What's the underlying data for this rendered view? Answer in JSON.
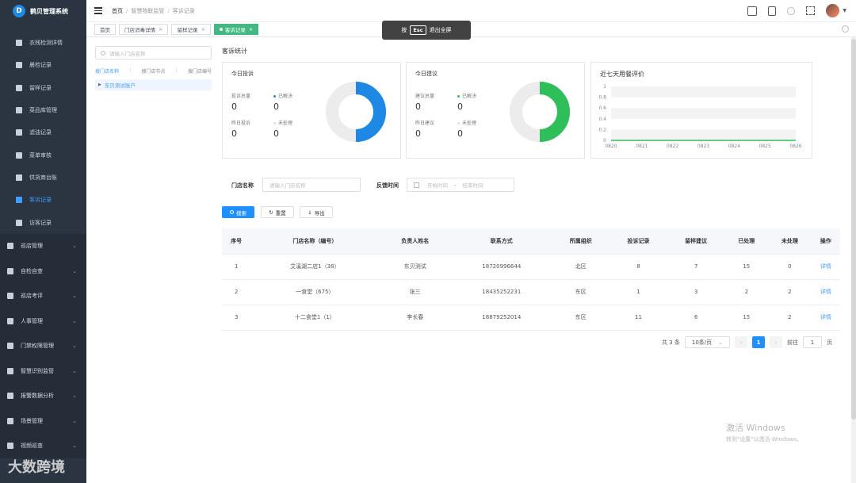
{
  "app": {
    "title": "鹤贝管理系统",
    "logo_letter": "D"
  },
  "sidebar": {
    "sub_items": [
      {
        "label": "衣残检测详情",
        "active": false
      },
      {
        "label": "晨检记录",
        "active": false
      },
      {
        "label": "留样记录",
        "active": false
      },
      {
        "label": "菜品库管理",
        "active": false
      },
      {
        "label": "滤油记录",
        "active": false
      },
      {
        "label": "菜单审核",
        "active": false
      },
      {
        "label": "供货商台账",
        "active": false
      },
      {
        "label": "客诉记录",
        "active": true
      },
      {
        "label": "访客记录",
        "active": false
      }
    ],
    "groups": [
      {
        "label": "巡店管理"
      },
      {
        "label": "自检自查"
      },
      {
        "label": "巡店考评"
      },
      {
        "label": "人事管理"
      },
      {
        "label": "门禁权限管理"
      },
      {
        "label": "智慧识别监管"
      },
      {
        "label": "报警数据分析"
      },
      {
        "label": "场景管理"
      },
      {
        "label": "视频巡查"
      }
    ],
    "watermark": "大数跨境"
  },
  "header": {
    "breadcrumb": [
      "首页",
      "智慧物联监管",
      "客诉记录"
    ]
  },
  "tabs": [
    {
      "label": "首页",
      "closable": false,
      "active": false
    },
    {
      "label": "门店消毒详情",
      "closable": true,
      "active": false
    },
    {
      "label": "留样记录",
      "closable": true,
      "active": false
    },
    {
      "label": "客诉记录",
      "closable": true,
      "active": true
    }
  ],
  "esc_overlay": {
    "prefix": "按",
    "key": "Esc",
    "suffix": "退出全屏"
  },
  "tree": {
    "search_placeholder": "请输入门店名称",
    "tabs": [
      "搜门店名称",
      "搜门店节点",
      "搜门店编号"
    ],
    "node": "东贝测试账户"
  },
  "stats": {
    "section_title": "客诉统计",
    "complaint": {
      "title": "今日投诉",
      "total_label": "投诉总量",
      "total": "0",
      "resolved_label": "已解决",
      "resolved": "0",
      "yesterday_label": "昨日投诉",
      "yesterday": "0",
      "unhandled_label": "未处理",
      "unhandled": "0",
      "color": "#1e88e5"
    },
    "suggestion": {
      "title": "今日建议",
      "total_label": "建议总量",
      "total": "0",
      "resolved_label": "已解决",
      "resolved": "0",
      "yesterday_label": "昨日建议",
      "yesterday": "0",
      "unhandled_label": "未处理",
      "unhandled": "0",
      "color": "#2fbf5a"
    },
    "rating": {
      "title": "近七天用餐评价"
    }
  },
  "chart_data": {
    "type": "line",
    "title": "近七天用餐评价",
    "categories": [
      "0820",
      "0821",
      "0822",
      "0823",
      "0824",
      "0825",
      "0826"
    ],
    "series": [
      {
        "values": [
          0,
          0,
          0,
          0,
          0,
          0,
          0
        ]
      }
    ],
    "yticks": [
      "0",
      "0.2",
      "0.4",
      "0.6",
      "0.8",
      "1"
    ],
    "ylim": [
      0,
      1
    ],
    "color": "#2fbf5a"
  },
  "filters": {
    "store_label": "门店名称",
    "store_placeholder": "请输入门店名称",
    "time_label": "反馈时间",
    "start_placeholder": "开始时间",
    "range_sep": "-",
    "end_placeholder": "结束时间",
    "search_btn": "搜索",
    "reset_btn": "重置",
    "export_btn": "导出"
  },
  "table": {
    "columns": [
      "序号",
      "门店名称（编号）",
      "负责人姓名",
      "联系方式",
      "所属组织",
      "投诉记录",
      "留样建议",
      "已处理",
      "未处理",
      "操作"
    ],
    "rows": [
      [
        "1",
        "艾溪湖二店1（38）",
        "东贝测试",
        "18720996644",
        "北区",
        "8",
        "7",
        "15",
        "0",
        "详情"
      ],
      [
        "2",
        "一食堂（675）",
        "张三",
        "18435252231",
        "东区",
        "1",
        "3",
        "2",
        "2",
        "详情"
      ],
      [
        "3",
        "十二食堂1（1）",
        "李长春",
        "18879252014",
        "东区",
        "11",
        "6",
        "15",
        "2",
        "详情"
      ]
    ]
  },
  "pagination": {
    "total_text": "共 3 条",
    "page_size": "10条/页",
    "current": "1",
    "goto_label": "前往",
    "goto_value": "1",
    "goto_suffix": "页"
  },
  "windows_watermark": {
    "line1": "激活 Windows",
    "line2": "转到\"设置\"以激活 Windows。"
  }
}
